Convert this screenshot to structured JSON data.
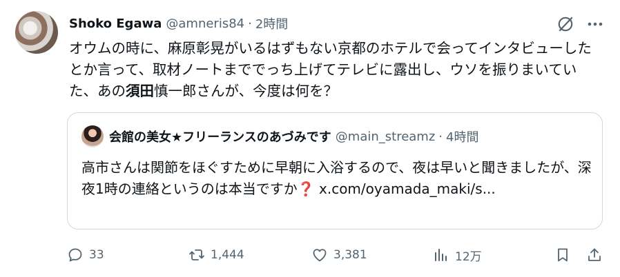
{
  "tweet": {
    "author_name": "Shoko Egawa",
    "author_handle": "@amneris84",
    "separator": "·",
    "time": "2時間",
    "text_part1": "オウムの時に、麻原彰晃がいるはずもない京都のホテルで会ってインタビューしたとか言って、取材ノートまででっち上げてテレビに露出し、ウソを振りまいていた、あの",
    "text_bold": "須田",
    "text_part2": "慎一郎さんが、今度は何を？"
  },
  "quote": {
    "author_name": "会館の美女★フリーランスのあづみです",
    "author_handle": "@main_streamz",
    "separator": "·",
    "time": "4時間",
    "text": "高市さんは関節をほぐすために早朝に入浴するので、夜は早いと聞きましたが、深夜1時の連絡というのは本当ですか",
    "emoji": "❓",
    "link": "x.com/oyamada_maki/s..."
  },
  "actions": {
    "replies": "33",
    "retweets": "1,444",
    "likes": "3,381",
    "views": "12万"
  },
  "icons": [
    "grok-icon",
    "more-icon",
    "reply-icon",
    "retweet-icon",
    "like-icon",
    "views-icon",
    "bookmark-icon",
    "share-icon"
  ],
  "colors": {
    "text": "#0f1419",
    "secondary": "#536471",
    "border": "#cfd9de"
  }
}
